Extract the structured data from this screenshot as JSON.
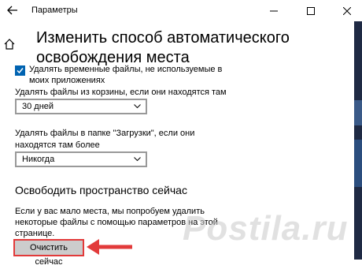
{
  "window": {
    "title": "Параметры"
  },
  "page": {
    "heading": "Изменить способ автоматического освобождения места"
  },
  "temp_files": {
    "checkbox_label": "Удалять временные файлы, не используемые в моих приложениях",
    "checked": true
  },
  "recycle_bin": {
    "label": "Удалять файлы из корзины, если они находятся там более",
    "selected": "30 дней"
  },
  "downloads": {
    "label": "Удалять файлы в папке \"Загрузки\", если они находятся там более",
    "selected": "Никогда"
  },
  "free_now": {
    "title": "Освободить пространство сейчас",
    "description": "Если у вас мало места, мы попробуем удалить некоторые файлы с помощью параметров на этой странице.",
    "button_label": "Очистить сейчас"
  },
  "watermark": {
    "text": "Postila.ru"
  },
  "colors": {
    "accent": "#0063b1",
    "highlight": "#e23a3a"
  }
}
